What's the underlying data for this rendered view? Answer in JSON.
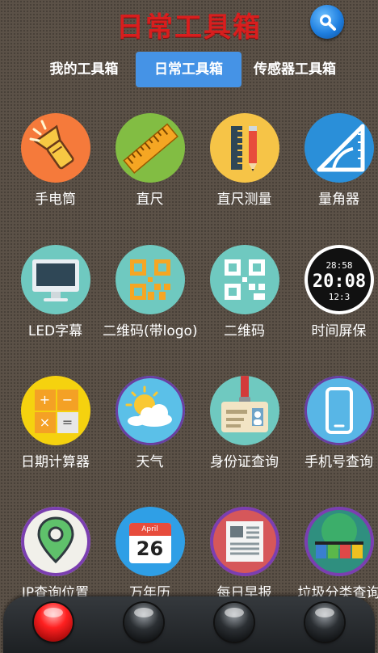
{
  "header": {
    "title": "日常工具箱"
  },
  "tabs": [
    {
      "label": "我的工具箱"
    },
    {
      "label": "日常工具箱",
      "active": true
    },
    {
      "label": "传感器工具箱"
    }
  ],
  "tools": [
    {
      "label": "手电筒",
      "icon": "flashlight-icon"
    },
    {
      "label": "直尺",
      "icon": "ruler-icon"
    },
    {
      "label": "直尺测量",
      "icon": "ruler-measure-icon"
    },
    {
      "label": "量角器",
      "icon": "protractor-icon"
    },
    {
      "label": "LED字幕",
      "icon": "monitor-icon"
    },
    {
      "label": "二维码(带logo)",
      "icon": "qr-logo-icon"
    },
    {
      "label": "二维码",
      "icon": "qr-icon"
    },
    {
      "label": "时间屏保",
      "icon": "clock-icon"
    },
    {
      "label": "日期计算器",
      "icon": "calculator-icon"
    },
    {
      "label": "天气",
      "icon": "weather-icon"
    },
    {
      "label": "身份证查询",
      "icon": "id-card-icon"
    },
    {
      "label": "手机号查询",
      "icon": "phone-icon"
    },
    {
      "label": "IP查询位置",
      "icon": "location-pin-icon"
    },
    {
      "label": "万年历",
      "icon": "calendar-icon"
    },
    {
      "label": "每日早报",
      "icon": "newspaper-icon"
    },
    {
      "label": "垃圾分类查询",
      "icon": "recycle-bins-icon"
    }
  ],
  "clock": {
    "time": "28:58",
    "big": "20:08",
    "small": "12:3"
  },
  "calendar": {
    "month": "April",
    "day": "26"
  },
  "calculator": {
    "plus": "+",
    "minus": "−",
    "times": "×",
    "equals": "="
  },
  "colors": {
    "title": "#d81e1e",
    "tab_active": "#4593e6",
    "nav_active": "#ff2020"
  }
}
